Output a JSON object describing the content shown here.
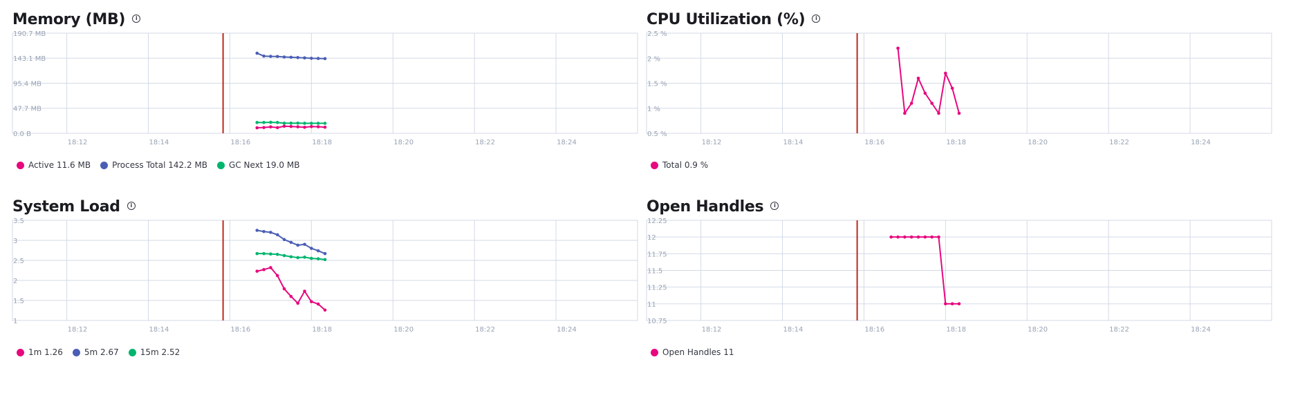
{
  "chart_data": [
    {
      "type": "line",
      "title": "Memory (MB)",
      "ylim": [
        0,
        190.7
      ],
      "yticks": [
        0,
        47.7,
        95.4,
        143.1,
        190.7
      ],
      "ytick_labels": [
        "0.0 B",
        "47.7 MB",
        "95.4 MB",
        "143.1 MB",
        "190.7 MB"
      ],
      "xlim": [
        "18:10:40",
        "18:26:00"
      ],
      "xticks": [
        "18:12",
        "18:14",
        "18:16",
        "18:18",
        "18:20",
        "18:22",
        "18:24"
      ],
      "marker_time": "18:15:50",
      "x": [
        "18:16:40",
        "18:16:50",
        "18:17:00",
        "18:17:10",
        "18:17:20",
        "18:17:30",
        "18:17:40",
        "18:17:50",
        "18:18:00",
        "18:18:10",
        "18:18:20"
      ],
      "series": [
        {
          "name": "Active",
          "color": "#e7077e",
          "legend_value": "11.6 MB",
          "values": [
            10.5,
            11.0,
            12.2,
            10.8,
            13.5,
            13.0,
            12.4,
            11.5,
            12.8,
            12.5,
            11.6
          ]
        },
        {
          "name": "Process Total",
          "color": "#4a5fb4",
          "legend_value": "142.2 MB",
          "values": [
            152.5,
            147.0,
            146.5,
            146.3,
            145.3,
            144.8,
            144.2,
            143.6,
            142.8,
            142.6,
            142.2
          ]
        },
        {
          "name": "GC Next",
          "color": "#00b46e",
          "legend_value": "19.0 MB",
          "values": [
            20.6,
            20.6,
            20.9,
            20.6,
            19.3,
            19.3,
            19.4,
            19.1,
            19.0,
            19.0,
            19.0
          ]
        }
      ]
    },
    {
      "type": "line",
      "title": "CPU Utilization (%)",
      "ylim": [
        0.5,
        2.5
      ],
      "yticks": [
        0.5,
        1,
        1.5,
        2,
        2.5
      ],
      "ytick_labels": [
        "0.5 %",
        "1 %",
        "1.5 %",
        "2 %",
        "2.5 %"
      ],
      "xlim": [
        "18:10:40",
        "18:26:00"
      ],
      "xticks": [
        "18:12",
        "18:14",
        "18:16",
        "18:18",
        "18:20",
        "18:22",
        "18:24"
      ],
      "marker_time": "18:15:50",
      "x": [
        "18:16:50",
        "18:17:00",
        "18:17:10",
        "18:17:20",
        "18:17:30",
        "18:17:40",
        "18:17:50",
        "18:18:00",
        "18:18:10",
        "18:18:20"
      ],
      "series": [
        {
          "name": "Total",
          "color": "#e7077e",
          "legend_value": "0.9 %",
          "values": [
            2.2,
            0.9,
            1.1,
            1.6,
            1.3,
            1.1,
            0.9,
            1.7,
            1.4,
            0.9
          ]
        }
      ]
    },
    {
      "type": "line",
      "title": "System Load",
      "ylim": [
        1,
        3.5
      ],
      "yticks": [
        1,
        1.5,
        2,
        2.5,
        3,
        3.5
      ],
      "ytick_labels": [
        "1",
        "1.5",
        "2",
        "2.5",
        "3",
        "3.5"
      ],
      "xlim": [
        "18:10:40",
        "18:26:00"
      ],
      "xticks": [
        "18:12",
        "18:14",
        "18:16",
        "18:18",
        "18:20",
        "18:22",
        "18:24"
      ],
      "marker_time": "18:15:50",
      "x": [
        "18:16:40",
        "18:16:50",
        "18:17:00",
        "18:17:10",
        "18:17:20",
        "18:17:30",
        "18:17:40",
        "18:17:50",
        "18:18:00",
        "18:18:10",
        "18:18:20"
      ],
      "series": [
        {
          "name": "1m",
          "color": "#e7077e",
          "legend_value": "1.26",
          "values": [
            2.23,
            2.27,
            2.32,
            2.12,
            1.79,
            1.6,
            1.43,
            1.73,
            1.47,
            1.41,
            1.26
          ]
        },
        {
          "name": "5m",
          "color": "#4a5fb4",
          "legend_value": "2.67",
          "values": [
            3.25,
            3.22,
            3.2,
            3.14,
            3.02,
            2.95,
            2.88,
            2.9,
            2.8,
            2.74,
            2.67
          ]
        },
        {
          "name": "15m",
          "color": "#00b46e",
          "legend_value": "2.52",
          "values": [
            2.67,
            2.67,
            2.66,
            2.65,
            2.62,
            2.59,
            2.57,
            2.58,
            2.55,
            2.54,
            2.52
          ]
        }
      ]
    },
    {
      "type": "line",
      "title": "Open Handles",
      "ylim": [
        10.75,
        12.25
      ],
      "yticks": [
        10.75,
        11,
        11.25,
        11.5,
        11.75,
        12,
        12.25
      ],
      "ytick_labels": [
        "10.75",
        "11",
        "11.25",
        "11.5",
        "11.75",
        "12",
        "12.25"
      ],
      "xlim": [
        "18:10:40",
        "18:26:00"
      ],
      "xticks": [
        "18:12",
        "18:14",
        "18:16",
        "18:18",
        "18:20",
        "18:22",
        "18:24"
      ],
      "marker_time": "18:15:50",
      "x": [
        "18:16:40",
        "18:16:50",
        "18:17:00",
        "18:17:10",
        "18:17:20",
        "18:17:30",
        "18:17:40",
        "18:17:50",
        "18:18:00",
        "18:18:10",
        "18:18:20"
      ],
      "series": [
        {
          "name": "Open Handles",
          "color": "#e7077e",
          "legend_value": "11",
          "values": [
            12,
            12,
            12,
            12,
            12,
            12,
            12,
            12,
            11,
            11,
            11
          ]
        }
      ]
    }
  ]
}
